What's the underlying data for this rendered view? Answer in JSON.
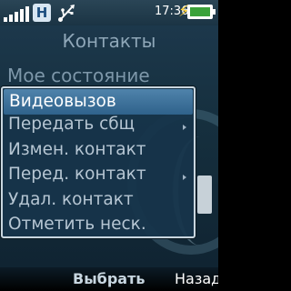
{
  "status_bar": {
    "signal_bars": 5,
    "network_badge": "H",
    "usb_icon": "usb-icon",
    "time": "17:36",
    "battery_icon": "battery-charging-icon"
  },
  "title": "Контакты",
  "background_item": "Мое состояние",
  "menu": {
    "items": [
      {
        "label": "Видеовызов",
        "selected": true,
        "submenu": false
      },
      {
        "label": "Передать сбщ",
        "selected": false,
        "submenu": true
      },
      {
        "label": "Измен. контакт",
        "selected": false,
        "submenu": false
      },
      {
        "label": "Перед. контакт",
        "selected": false,
        "submenu": true
      },
      {
        "label": "Удал. контакт",
        "selected": false,
        "submenu": false
      },
      {
        "label": "Отметить неск.",
        "selected": false,
        "submenu": false
      }
    ]
  },
  "softkeys": {
    "select": "Выбрать",
    "back": "Назад"
  }
}
